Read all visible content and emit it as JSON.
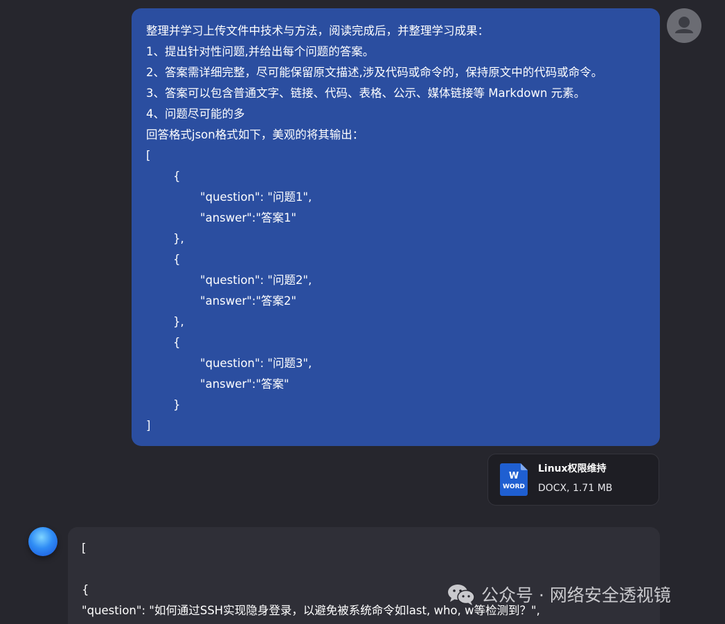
{
  "user_message": {
    "lines": [
      "整理并学习上传文件中技术与方法，阅读完成后，并整理学习成果：",
      "1、提出针对性问题,并给出每个问题的答案。",
      "2、答案需详细完整，尽可能保留原文描述,涉及代码或命令的，保持原文中的代码或命令。",
      "3、答案可以包含普通文字、链接、代码、表格、公示、媒体链接等 Markdown 元素。",
      "4、问题尽可能的多",
      "回答格式json格式如下，美观的将其输出：",
      "[",
      "{",
      "\"question\": \"问题1\",",
      "\"answer\":\"答案1\"",
      "},",
      "{",
      "\"question\": \"问题2\",",
      "\"answer\":\"答案2\"",
      "},",
      "{",
      "\"question\": \"问题3\",",
      "\"answer\":\"答案\"",
      "}",
      "]"
    ]
  },
  "attachment": {
    "icon_label_w": "W",
    "icon_label_word": "WORD",
    "file_name": "Linux权限维持",
    "file_meta": "DOCX, 1.71 MB",
    "icon": "word-document-icon",
    "icon_color": "#1f5fd1"
  },
  "bot_message": {
    "lines": [
      "[",
      "",
      "{",
      "\"question\": \"如何通过SSH实现隐身登录，以避免被系统命令如last, who, w等检测到？\","
    ]
  },
  "watermark": {
    "text": "公众号 · 网络安全透视镜",
    "icon": "wechat-icon"
  },
  "colors": {
    "background": "#26262d",
    "user_bubble": "#2b4ea0",
    "bot_bubble": "#2f2f37"
  }
}
